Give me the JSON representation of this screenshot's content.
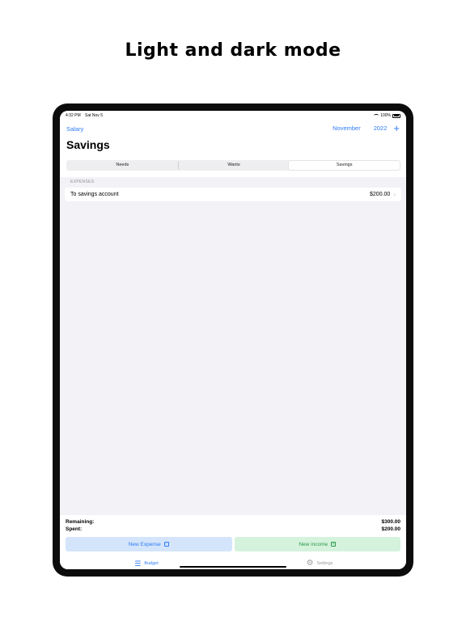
{
  "headline": "Light and dark mode",
  "status_bar": {
    "time": "4:32 PM",
    "date": "Sat Nov 5",
    "battery": "100%"
  },
  "nav": {
    "back_label": "Salary",
    "month": "November",
    "year": "2022",
    "add_icon": "plus-icon"
  },
  "page_title": "Savings",
  "segments": [
    {
      "label": "Needs",
      "selected": false
    },
    {
      "label": "Wants",
      "selected": false
    },
    {
      "label": "Savings",
      "selected": true
    }
  ],
  "expenses": {
    "section_label": "EXPENSES",
    "items": [
      {
        "name": "To savings account",
        "amount": "$200.00"
      }
    ]
  },
  "totals": {
    "remaining_label": "Remaining:",
    "remaining_value": "$300.00",
    "spent_label": "Spent:",
    "spent_value": "$200.00"
  },
  "actions": {
    "new_expense": "New Expense",
    "new_income": "New income"
  },
  "tabs": [
    {
      "label": "Budget",
      "icon": "list-icon",
      "active": true
    },
    {
      "label": "Settings",
      "icon": "gear-icon",
      "active": false
    }
  ],
  "colors": {
    "accent": "#2f7cf6",
    "income": "#2c9a4e",
    "background": "#f2f2f7"
  }
}
